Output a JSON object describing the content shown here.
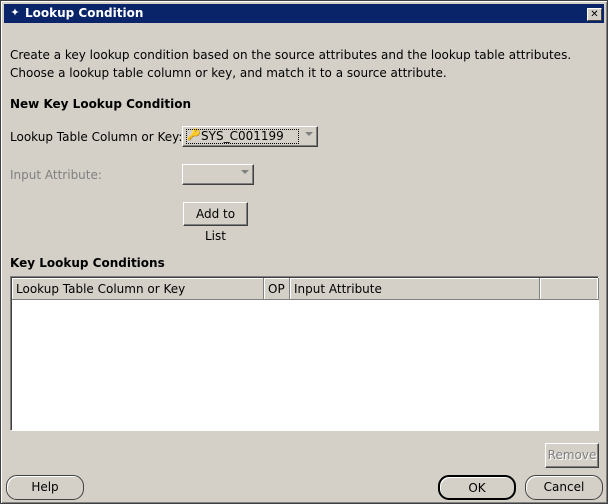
{
  "window": {
    "title": "Lookup Condition",
    "close_glyph": "✕"
  },
  "description": "Create a key lookup condition based on the source attributes and the lookup table attributes.  Choose a lookup table column or key, and match it to a source attribute.",
  "new_condition": {
    "heading": "New Key Lookup Condition",
    "lookup_label": "Lookup Table Column or Key:",
    "lookup_value": "SYS_C001199",
    "lookup_icon": "key-icon",
    "input_attr_label": "Input Attribute:",
    "input_attr_value": "",
    "add_button": "Add to List"
  },
  "conditions": {
    "heading": "Key Lookup Conditions",
    "columns": [
      "Lookup Table Column or Key",
      "OP",
      "Input Attribute",
      ""
    ],
    "rows": []
  },
  "buttons": {
    "remove": "Remove",
    "help": "Help",
    "ok": "OK",
    "cancel": "Cancel"
  }
}
